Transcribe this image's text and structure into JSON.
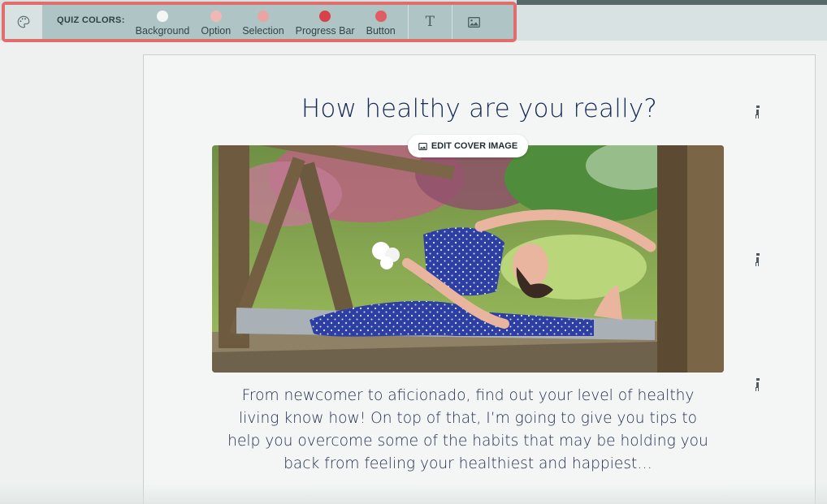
{
  "toolbar": {
    "colors_label": "QUIZ COLORS:",
    "palette_icon": "palette-icon",
    "swatches": [
      {
        "label": "Background",
        "color": "#f3f6f5"
      },
      {
        "label": "Option",
        "color": "#f2b7b4"
      },
      {
        "label": "Selection",
        "color": "#e9a4a4"
      },
      {
        "label": "Progress Bar",
        "color": "#d7424a"
      },
      {
        "label": "Button",
        "color": "#e05d63"
      }
    ],
    "text_tool_glyph": "T",
    "text_tool_icon": "text-icon",
    "image_tool_icon": "image-icon",
    "highlight_color": "#e16d6d"
  },
  "quiz": {
    "title": "How healthy are you really?",
    "edit_cover_label": "EDIT COVER IMAGE",
    "description": "From newcomer to aficionado, find out your level of healthy living know how! On top of that, I’m going to give you tips to help you overcome some of the habits that may be holding you back from feeling your healthiest and happiest…"
  }
}
